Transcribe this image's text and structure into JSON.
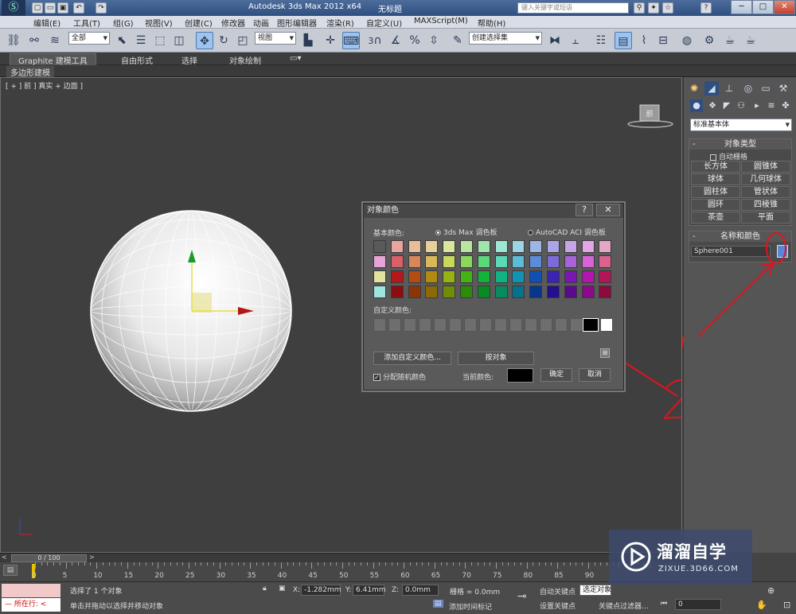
{
  "titlebar": {
    "app_title": "Autodesk 3ds Max  2012 x64",
    "doc_title": "无标题",
    "search_placeholder": "键入关键字或短语",
    "minimize": "─",
    "maximize": "□",
    "close": "✕"
  },
  "menu": [
    "编辑(E)",
    "工具(T)",
    "组(G)",
    "视图(V)",
    "创建(C)",
    "修改器",
    "动画",
    "图形编辑器",
    "渲染(R)",
    "自定义(U)",
    "MAXScript(M)",
    "帮助(H)"
  ],
  "toolbar": {
    "filter": "全部",
    "refcoord": "视图",
    "named_selection": "创建选择集",
    "snap_label": "3"
  },
  "ribbon": {
    "tabs": [
      "Graphite 建模工具",
      "自由形式",
      "选择",
      "对象绘制"
    ],
    "sub_tab": "多边形建模"
  },
  "viewport": {
    "label": "[ + ] 前 ] 真实 + 边面 ]",
    "viewcube": "前"
  },
  "command_panel": {
    "category": "标准基本体",
    "object_type_header": "对象类型",
    "autogrid": "自动栅格",
    "object_buttons": [
      "长方体",
      "圆锥体",
      "球体",
      "几何球体",
      "圆柱体",
      "管状体",
      "圆环",
      "四棱锥",
      "茶壶",
      "平面"
    ],
    "name_color_header": "名称和颜色",
    "object_name": "Sphere001",
    "object_color": "#5b86d6"
  },
  "dialog": {
    "title": "对象颜色",
    "help": "?",
    "close": "✕",
    "basic_colors_label": "基本颜色:",
    "palette_max": "3ds Max 调色板",
    "palette_aci": "AutoCAD ACI 调色板",
    "palette": [
      [
        "#5a5a5a",
        "#e8a5a0",
        "#e8bd99",
        "#e6cf9a",
        "#d9e69c",
        "#b8e69e",
        "#9ee6ae",
        "#9de6d3",
        "#9dd4e6",
        "#9db6e6",
        "#aaa6e6",
        "#c6a5e6",
        "#e3a5e6",
        "#e6a6c6"
      ],
      [
        "#e6a3d7",
        "#d86068",
        "#d8865a",
        "#d8b85b",
        "#c8d85c",
        "#8cd85c",
        "#5cd87a",
        "#5cd8b4",
        "#5cbdd8",
        "#5c8cd8",
        "#7d6cd8",
        "#a863d8",
        "#d764d6",
        "#d8638f"
      ],
      [
        "#e2e29e",
        "#b31919",
        "#b34d11",
        "#b38a11",
        "#96b311",
        "#45b311",
        "#11b338",
        "#11b384",
        "#1194b3",
        "#1150b3",
        "#3b23b3",
        "#7a17b3",
        "#b315b0",
        "#b31558"
      ],
      [
        "#9ee5e0",
        "#8c0d0d",
        "#8c3507",
        "#8c6907",
        "#718c07",
        "#2a8c07",
        "#078c23",
        "#078c62",
        "#07708c",
        "#07378c",
        "#22108c",
        "#5a0b8c",
        "#8c098a",
        "#8c0a3e"
      ]
    ],
    "custom_label": "自定义颜色:",
    "custom_selected": "#000000",
    "btn_add_custom": "添加自定义颜色...",
    "btn_by_object": "按对象",
    "assign_random": "分配随机颜色",
    "current_color_label": "当前颜色:",
    "current_color": "#000000",
    "btn_ok": "确定",
    "btn_cancel": "取消"
  },
  "timeline": {
    "frame": "0 / 100",
    "ticks": [
      "0",
      "5",
      "10",
      "15",
      "20",
      "25",
      "30",
      "35",
      "40",
      "45",
      "50",
      "55",
      "60",
      "65",
      "70",
      "75",
      "80",
      "85",
      "90"
    ]
  },
  "status": {
    "running": "所在行:",
    "selected": "选择了 1 个对象",
    "prompt": "单击并拖动以选择并移动对象",
    "x_label": "X:",
    "x_val": "-1.282mm",
    "y_label": "Y:",
    "y_val": "6.41mm",
    "z_label": "Z:",
    "z_val": "0.0mm",
    "grid": "栅格 = 0.0mm",
    "add_time_tag": "添加时间标记",
    "auto_key": "自动关键点",
    "selected_obj": "选定对象",
    "set_key": "设置关键点",
    "key_filter": "关键点过滤器...",
    "frame_field": "0"
  },
  "watermark": {
    "brand": "溜溜自学",
    "url": "ZIXUE.3D66.COM"
  }
}
